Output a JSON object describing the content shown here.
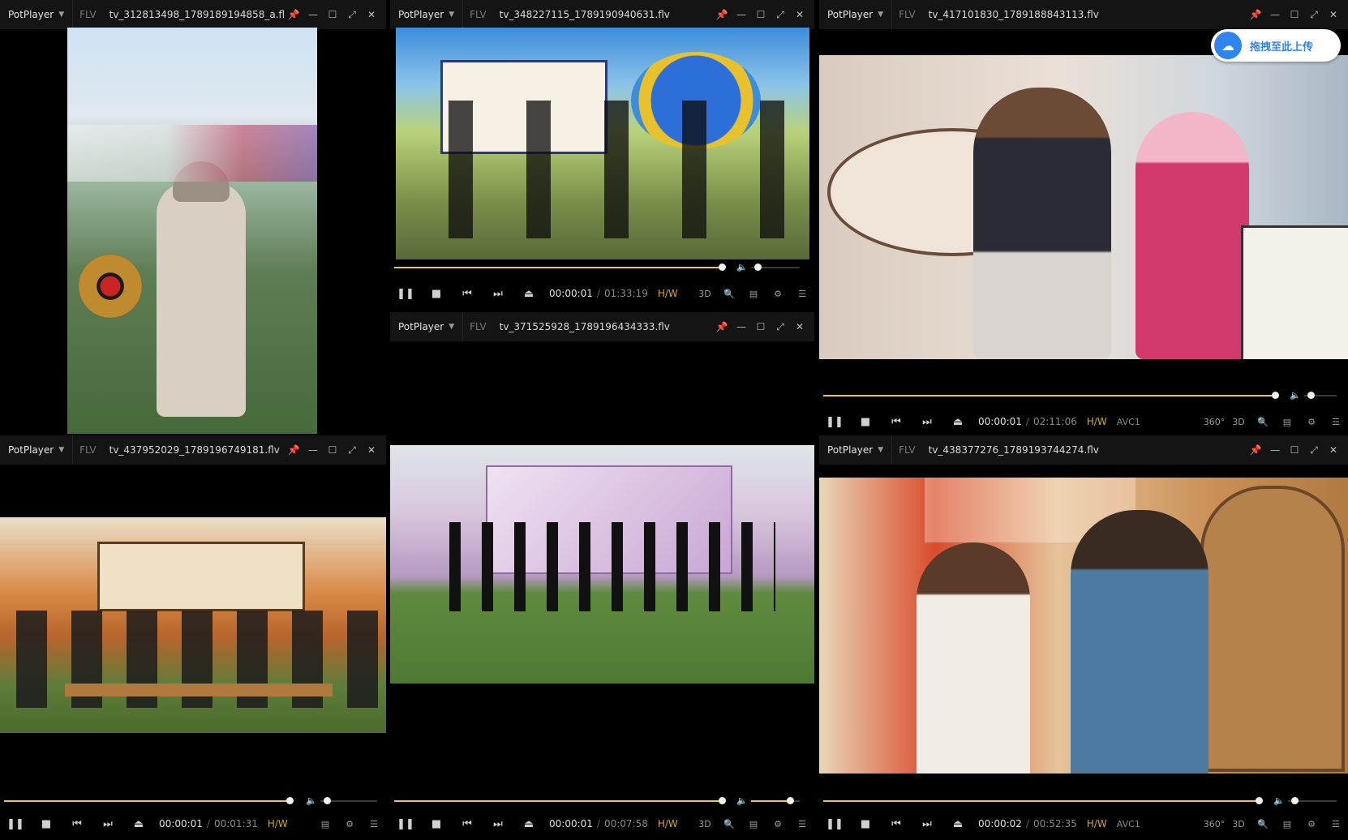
{
  "app_name": "PotPlayer",
  "format": "FLV",
  "colors": {
    "accent": "#e8c84a",
    "hw": "#d6a928",
    "upload_blue": "#2f84f0"
  },
  "upload_badge": {
    "label": "拖拽至此上传",
    "icon": "cloud-upload-icon"
  },
  "windows": [
    {
      "id": "w1",
      "filename": "tv_312813498_1789189194858_a.fl",
      "content": "outdoor festival lawn, woman in cap holding phone, booth with gong"
    },
    {
      "id": "w2",
      "filename": "tv_348227115_1789190940631.flv",
      "content": "dancers on stage with colorful graphic backdrop",
      "time_current": "00:00:01",
      "time_total": "01:33:19",
      "hw": "H/W",
      "progress": 0.86,
      "volume": 0.1,
      "icons": [
        "3D",
        "capture-icon",
        "playlist-icon",
        "settings-icon",
        "menu-icon"
      ]
    },
    {
      "id": "w3",
      "filename": "tv_417101830_1789188843113.flv",
      "content": "two cosplayers on stage with playing-card props",
      "time_current": "00:00:01",
      "time_total": "02:11:06",
      "hw": "H/W",
      "codec": "AVC1",
      "progress": 0.98,
      "volume": 0.1,
      "icons": [
        "360°",
        "3D",
        "capture-icon",
        "playlist-icon",
        "settings-icon",
        "menu-icon"
      ]
    },
    {
      "id": "w4",
      "filename": "tv_371525928_1789196434333.flv",
      "content": "group posing on lawn in front of event backdrop"
    },
    {
      "id": "w5",
      "filename": "tv_437952029_1789196749181.flv",
      "content": "panel of guests seated at wooden table in tent booth",
      "time_current": "00:00:01",
      "time_total": "00:01:31",
      "hw": "H/W",
      "progress": 0.78,
      "volume": 0.1,
      "icons": [
        "playlist-icon",
        "settings-icon",
        "menu-icon"
      ]
    },
    {
      "id": "w6",
      "filename": "",
      "content": "",
      "time_current": "00:00:01",
      "time_total": "00:07:58",
      "hw": "H/W",
      "progress": 0.86,
      "volume": 0.75,
      "icons": [
        "3D",
        "capture-icon",
        "playlist-icon",
        "settings-icon",
        "menu-icon"
      ]
    },
    {
      "id": "w7",
      "filename": "tv_438377276_1789193744274.flv",
      "content": "two hosts at booth with illustrated wooden door backdrop",
      "time_current": "00:00:02",
      "time_total": "00:52:35",
      "hw": "H/W",
      "codec": "AVC1",
      "progress": 0.86,
      "volume": 0.1,
      "icons": [
        "360°",
        "3D",
        "capture-icon",
        "playlist-icon",
        "settings-icon",
        "menu-icon"
      ]
    }
  ]
}
